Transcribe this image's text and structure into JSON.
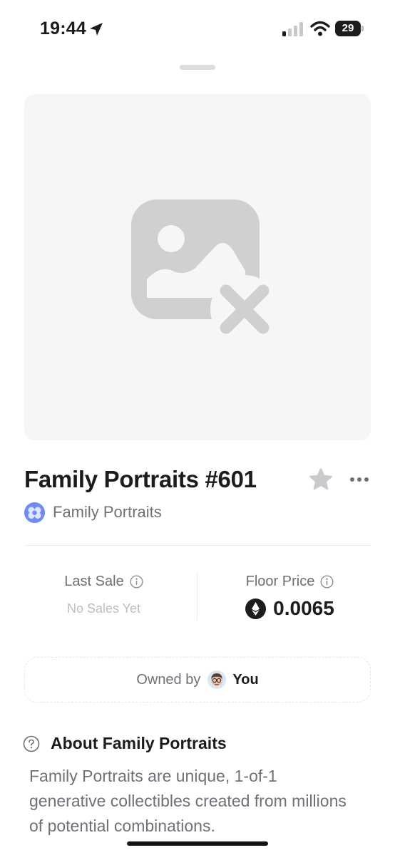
{
  "status_bar": {
    "time": "19:44",
    "battery": "29",
    "icons": [
      "location-arrow-icon",
      "cellular-signal-icon",
      "wifi-icon",
      "battery-icon"
    ]
  },
  "nft": {
    "title": "Family Portraits #601",
    "collection_name": "Family Portraits",
    "image_state": "missing-image-icon"
  },
  "stats": {
    "last_sale_label": "Last Sale",
    "last_sale_value": "No Sales Yet",
    "floor_price_label": "Floor Price",
    "floor_price_value": "0.0065",
    "currency_icon": "ethereum-icon"
  },
  "ownership": {
    "owned_by_label": "Owned by",
    "owner_name": "You"
  },
  "about": {
    "title": "About Family Portraits",
    "description": "Family Portraits are unique, 1-of-1 generative collectibles created from millions of potential combinations."
  },
  "colors": {
    "accent_collection": "#6f8bf5",
    "text_primary": "#1c1c1e",
    "text_secondary": "#707078",
    "placeholder_bg": "#f6f6f6"
  }
}
